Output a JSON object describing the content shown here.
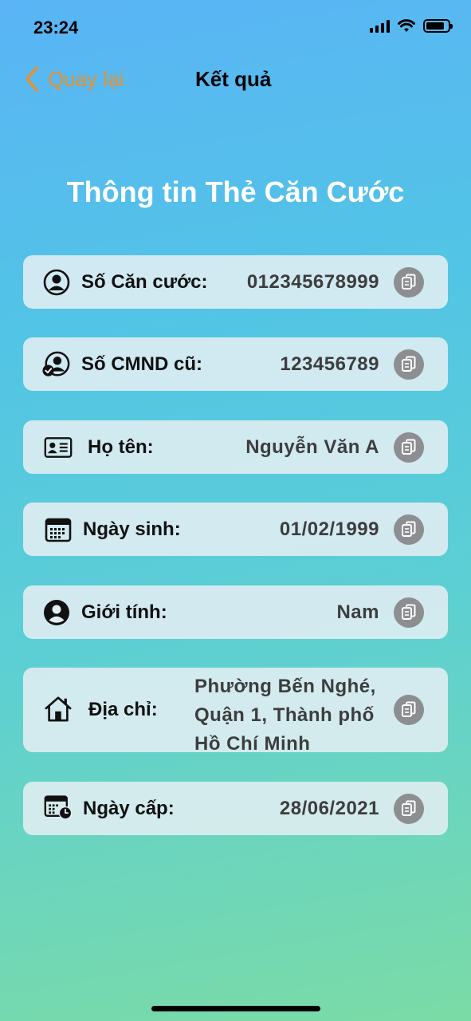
{
  "status_bar": {
    "time": "23:24"
  },
  "nav": {
    "back_label": "Quay lại",
    "title": "Kết quả"
  },
  "page": {
    "title": "Thông tin Thẻ Căn Cước"
  },
  "fields": [
    {
      "label": "Số Căn cước:",
      "value": "012345678999",
      "icon": "person-circle-icon"
    },
    {
      "label": "Số CMND cũ:",
      "value": "123456789",
      "icon": "person-check-icon"
    },
    {
      "label": "Họ tên:",
      "value": "Nguyễn Văn A",
      "icon": "id-card-icon"
    },
    {
      "label": "Ngày sinh:",
      "value": "01/02/1999",
      "icon": "calendar-icon"
    },
    {
      "label": "Giới tính:",
      "value": "Nam",
      "icon": "person-fill-icon"
    },
    {
      "label": "Địa chỉ:",
      "value": "Phường Bến Nghé, Quận 1, Thành phố Hồ Chí Minh",
      "icon": "house-icon"
    },
    {
      "label": "Ngày cấp:",
      "value": "28/06/2021",
      "icon": "calendar-clock-icon"
    }
  ],
  "colors": {
    "accent": "#e8912c",
    "copy_button": "#8d8e91"
  }
}
